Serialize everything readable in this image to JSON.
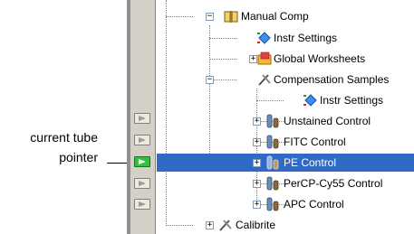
{
  "callout": {
    "line1": "current tube",
    "line2": "pointer"
  },
  "tree": {
    "nodes": [
      {
        "label": "Manual Comp",
        "expander": "−",
        "icon": "book-icon"
      },
      {
        "label": "Instr Settings",
        "expander": "",
        "icon": "instr-settings-icon"
      },
      {
        "label": "Global Worksheets",
        "expander": "+",
        "icon": "worksheet-folder-icon"
      },
      {
        "label": "Compensation Samples",
        "expander": "−",
        "icon": "specimen-tools-icon"
      },
      {
        "label": "Instr Settings",
        "expander": "",
        "icon": "instr-settings-icon"
      },
      {
        "label": "Unstained Control",
        "expander": "+",
        "icon": "tube-icon"
      },
      {
        "label": "FITC Control",
        "expander": "+",
        "icon": "tube-icon"
      },
      {
        "label": "PE Control",
        "expander": "+",
        "icon": "tube-icon",
        "selected": true
      },
      {
        "label": "PerCP-Cy55 Control",
        "expander": "+",
        "icon": "tube-icon"
      },
      {
        "label": "APC Control",
        "expander": "+",
        "icon": "tube-icon"
      },
      {
        "label": "Calibrite",
        "expander": "+",
        "icon": "specimen-tools-icon"
      }
    ]
  },
  "tube_pointers": [
    {
      "state": "inactive"
    },
    {
      "state": "inactive"
    },
    {
      "state": "current"
    },
    {
      "state": "inactive"
    },
    {
      "state": "inactive"
    }
  ]
}
